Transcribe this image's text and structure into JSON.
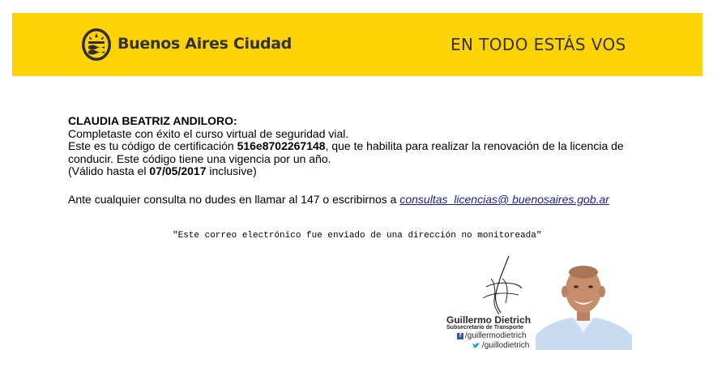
{
  "banner": {
    "brand_name": "Buenos Aires Ciudad",
    "slogan": "EN TODO ESTÁS VOS",
    "background_color": "#fdd306",
    "logo_icon": "city-seal-icon"
  },
  "message": {
    "recipient": "CLAUDIA BEATRIZ ANDILORO:",
    "line_completed": "Completaste con éxito el curso virtual de seguridad vial.",
    "code_intro": "Este es tu código de certificación ",
    "code": "516e8702267148",
    "code_outro": ", que te habilita para realizar la renovación de la licencia de conducir. Este código tiene una vigencia por un año.",
    "valid_prefix": "(Válido hasta el ",
    "valid_date": "07/05/2017",
    "valid_suffix": " inclusive)"
  },
  "contact": {
    "text": "Ante cualquier consulta no dudes en llamar al 147 o escribirnos a ",
    "email": "consultas_licencias@ buenosaires.gob.ar"
  },
  "notice": "\"Este correo electrónico fue enviado de una dirección no monitoreada\"",
  "signature": {
    "name": "Guillermo Dietrich",
    "title": "Subsecretario de Transporte",
    "facebook": "/guillermodietrich",
    "twitter": "/guillodietrich",
    "facebook_icon": "facebook-icon",
    "twitter_icon": "twitter-icon"
  }
}
